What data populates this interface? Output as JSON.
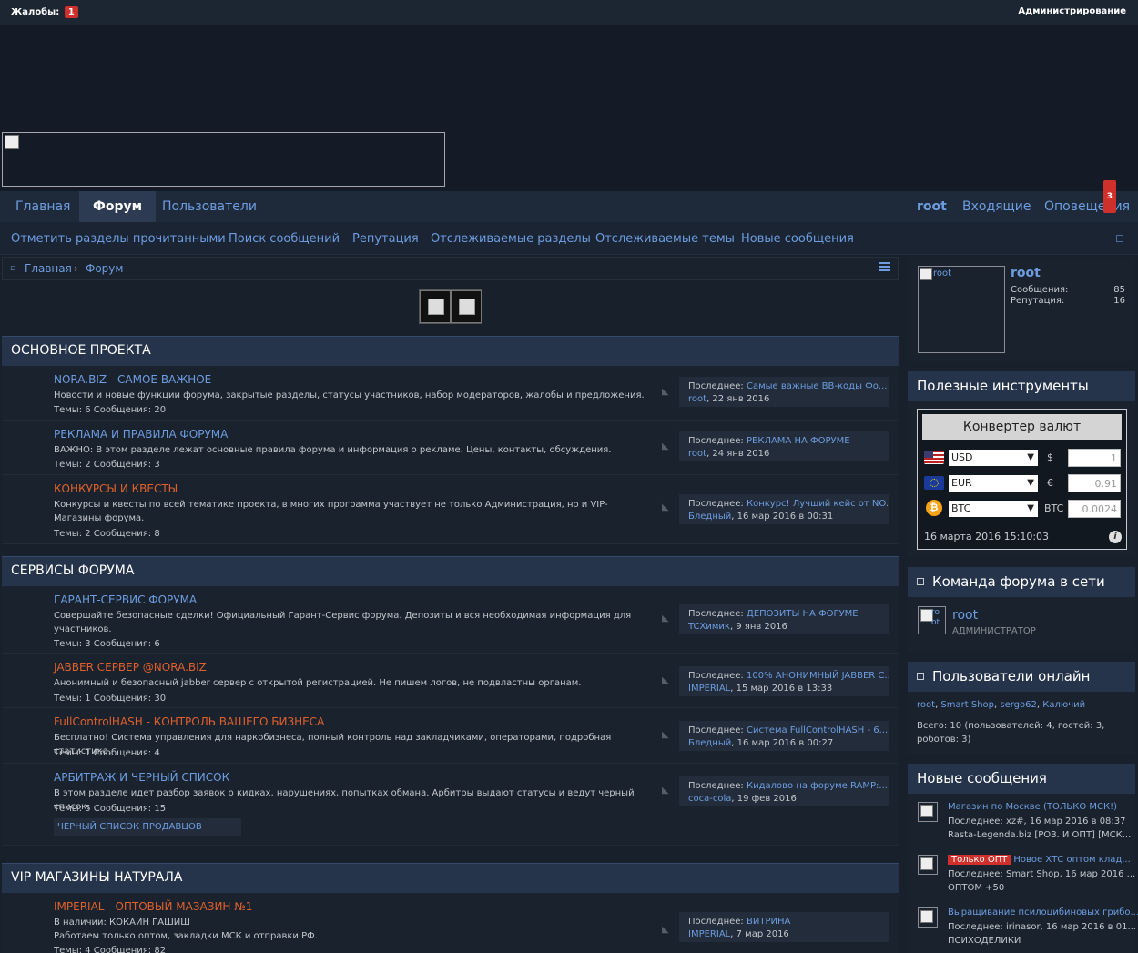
{
  "topbar": {
    "complaints_label": "Жалобы:",
    "complaints_count": "1",
    "admin_link": "Администрирование"
  },
  "nav": {
    "tabs": [
      {
        "label": "Главная"
      },
      {
        "label": "Форум"
      },
      {
        "label": "Пользователи"
      }
    ],
    "user": "root",
    "inbox": "Входящие",
    "alerts": "Оповещения",
    "alerts_count": "3"
  },
  "subnav": [
    "Отметить разделы прочитанными",
    "Поиск сообщений",
    "Репутация",
    "Отслеживаемые разделы",
    "Отслеживаемые темы",
    "Новые сообщения"
  ],
  "breadcrumb": {
    "home": "Главная",
    "forum": "Форум"
  },
  "categories": [
    {
      "title": "ОСНОВНОЕ ПРОЕКТА"
    },
    {
      "title": "СЕРВИСЫ ФОРУМА"
    },
    {
      "title": "VIP МАГАЗИНЫ НАТУРАЛА"
    }
  ],
  "forums": [
    {
      "title": "NORA.BIZ - САМОЕ ВАЖНОЕ",
      "desc": "Новости и новые функции форума, закрытые разделы, статусы участников, набор модераторов, жалобы и предложения.",
      "stats": "Темы: 6 Сообщения: 20",
      "last_label": "Последнее:",
      "last_title": "Самые важные BB-коды Фо...",
      "last_user": "root",
      "last_date": ", 22 янв 2016"
    },
    {
      "title": "РЕКЛАМА И ПРАВИЛА ФОРУМА",
      "desc": "ВАЖНО: В этом разделе лежат основные правила форума и информация о рекламе. Цены, контакты, обсуждения.",
      "stats": "Темы: 2 Сообщения: 3",
      "last_label": "Последнее:",
      "last_title": "РЕКЛАМА НА ФОРУМЕ",
      "last_user": "root",
      "last_date": ", 24 янв 2016"
    },
    {
      "title": "КОНКУРСЫ И КВЕСТЫ",
      "desc": "Конкурсы и квесты по всей тематике проекта, в многих программа участвует не только Администрация, но и VIP-Магазины форума.",
      "stats": "Темы: 2 Сообщения: 8",
      "last_label": "Последнее:",
      "last_title": "Конкурс! Лучший кейс от NO...",
      "last_user": "Бледный",
      "last_date": ", 16 мар 2016 в 00:31"
    },
    {
      "title": "ГАРАНТ-СЕРВИС ФОРУМА",
      "desc": "Совершайте безопасные сделки! Официальный Гарант-Сервис форума. Депозиты и вся необходимая информация для участников.",
      "stats": "Темы: 3 Сообщения: 6",
      "last_label": "Последнее:",
      "last_title": "ДЕПОЗИТЫ НА ФОРУМЕ",
      "last_user": "TCXимик",
      "last_date": ", 9 янв 2016"
    },
    {
      "title": "JABBER СЕРВЕР @NORA.BIZ",
      "desc": "Анонимный и безопасный jabber сервер с открытой регистрацией. Не пишем логов, не подвластны органам.",
      "stats": "Темы: 1 Сообщения: 30",
      "last_label": "Последнее:",
      "last_title": "100% АНОНИМНЫЙ JABBER С...",
      "last_user": "IMPERIAL",
      "last_date": ", 15 мар 2016 в 13:33"
    },
    {
      "title": "FullControlHASH - КОНТРОЛЬ ВАШЕГО БИЗНЕСА",
      "desc": "Бесплатно! Система управления для наркобизнеса, полный контроль над закладчиками, операторами, подробная статистика.",
      "stats": "Темы: 1 Сообщения: 4",
      "last_label": "Последнее:",
      "last_title": "Система FullControlHASH - 6...",
      "last_user": "Бледный",
      "last_date": ", 16 мар 2016 в 00:27"
    },
    {
      "title": "АРБИТРАЖ И ЧЕРНЫЙ СПИСОК",
      "desc": "В этом разделе идет разбор заявок о кидках, нарушениях, попытках обмана. Арбитры выдают статусы и ведут черный список.",
      "stats": "Темы: 5 Сообщения: 15",
      "sub": "ЧЕРНЫЙ СПИСОК ПРОДАВЦОВ",
      "last_label": "Последнее:",
      "last_title": "Кидалово на форуме RAMP:...",
      "last_user": "coca-cola",
      "last_date": ", 19 фев 2016"
    },
    {
      "title": "IMPERIAL - ОПТОВЫЙ МАЗАЗИН №1",
      "desc": "В наличии: КОКАИН ГАШИШ",
      "desc2": "Работаем только оптом, закладки МСК и отправки РФ.",
      "stats": "Темы: 4 Сообщения: 82",
      "last_label": "Последнее:",
      "last_title": "ВИТРИНА",
      "last_user": "IMPERIAL",
      "last_date": ", 7 мар 2016"
    }
  ],
  "sidebar": {
    "profile": {
      "avatar_alt": "root",
      "name": "root",
      "posts_label": "Сообщения:",
      "posts": "85",
      "rep_label": "Репутация:",
      "rep": "16"
    },
    "tools_title": "Полезные инструменты",
    "converter": {
      "button": "Конвертер валют",
      "rows": [
        {
          "currency": "USD",
          "symbol": "$",
          "value": "1"
        },
        {
          "currency": "EUR",
          "symbol": "€",
          "value": "0.91"
        },
        {
          "currency": "BTC",
          "symbol": "BTC",
          "value": "0.0024"
        }
      ],
      "date": "16 марта 2016 15:10:03",
      "info": "i"
    },
    "team_title": "Команда форума в сети",
    "team": {
      "avatar_alt": "ro ot",
      "name": "root",
      "role": "АДМИНИСТРАТОР"
    },
    "online_title": "Пользователи онлайн",
    "online_users": [
      "root",
      "Smart Shop",
      "sergo62",
      "Калючий"
    ],
    "online_total": "Всего: 10 (пользователей: 4, гостей: 3,",
    "online_total2": "роботов: 3)",
    "new_title": "Новые сообщения",
    "new_posts": [
      {
        "tag": "",
        "title": "Магазин по Москве (ТОЛЬКО МСК!)",
        "last": "Последнее: xz#, 16 мар 2016 в 08:37",
        "forum": "Rasta-Legenda.biz [РОЗ. И ОПТ] [МСК..."
      },
      {
        "tag": "Только ОПТ",
        "title": "Новое ХТС оптом клад...",
        "last": "Последнее: Smart Shop, 16 мар 2016 ...",
        "forum": "ОПТОМ +50"
      },
      {
        "tag": "",
        "title": "Выращивание псилоцибиновых грибо...",
        "last": "Последнее: irinasor, 16 мар 2016 в 01...",
        "forum": "ПСИХОДЕЛИКИ"
      }
    ]
  },
  "colors": {
    "accent": "#6d9de0",
    "hot": "#e0602c",
    "badge": "#d0302c",
    "header": "#25344a"
  }
}
